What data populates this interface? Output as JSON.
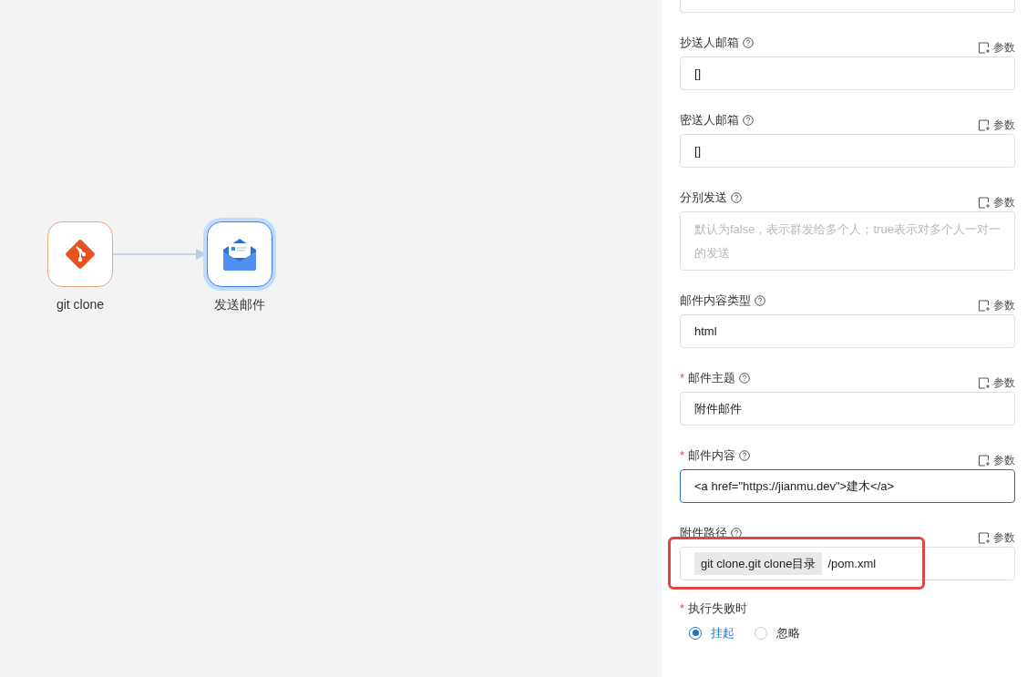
{
  "canvas": {
    "nodes": [
      {
        "kind": "git",
        "label": "git clone",
        "selected": false
      },
      {
        "kind": "mail",
        "label": "发送邮件",
        "selected": true
      }
    ]
  },
  "panel": {
    "fields": [
      {
        "label": "抄送人邮箱",
        "kind": "input",
        "value": "[]",
        "focused": false,
        "highlighted": false,
        "param": "参数"
      },
      {
        "label": "密送人邮箱",
        "kind": "input",
        "value": "[]",
        "focused": false,
        "highlighted": false,
        "param": "参数"
      },
      {
        "label": "分别发送",
        "kind": "textarea",
        "placeholder": "默认为false，表示群发给多个人；true表示对多个人一对一的发送",
        "focused": false,
        "highlighted": false,
        "param": "参数"
      },
      {
        "label": "邮件内容类型",
        "kind": "input",
        "value": "html",
        "focused": false,
        "highlighted": false,
        "param": "参数"
      },
      {
        "label": "邮件主题",
        "required_mark": "*",
        "kind": "input",
        "value": "附件邮件",
        "focused": false,
        "highlighted": false,
        "param": "参数"
      },
      {
        "label": "邮件内容",
        "required_mark": "*",
        "kind": "input",
        "value": "<a href=\"https://jianmu.dev\">建木</a>",
        "focused": true,
        "highlighted": false,
        "param": "参数"
      },
      {
        "label": "附件路径",
        "kind": "ref",
        "ref": "git clone.git clone目录",
        "value": "/pom.xml",
        "focused": false,
        "highlighted": true,
        "param": "参数"
      }
    ],
    "on_failure": {
      "label": "执行失败时",
      "required_mark": "*",
      "options": [
        {
          "label": "挂起",
          "selected": true
        },
        {
          "label": "忽略",
          "selected": false
        }
      ]
    }
  }
}
